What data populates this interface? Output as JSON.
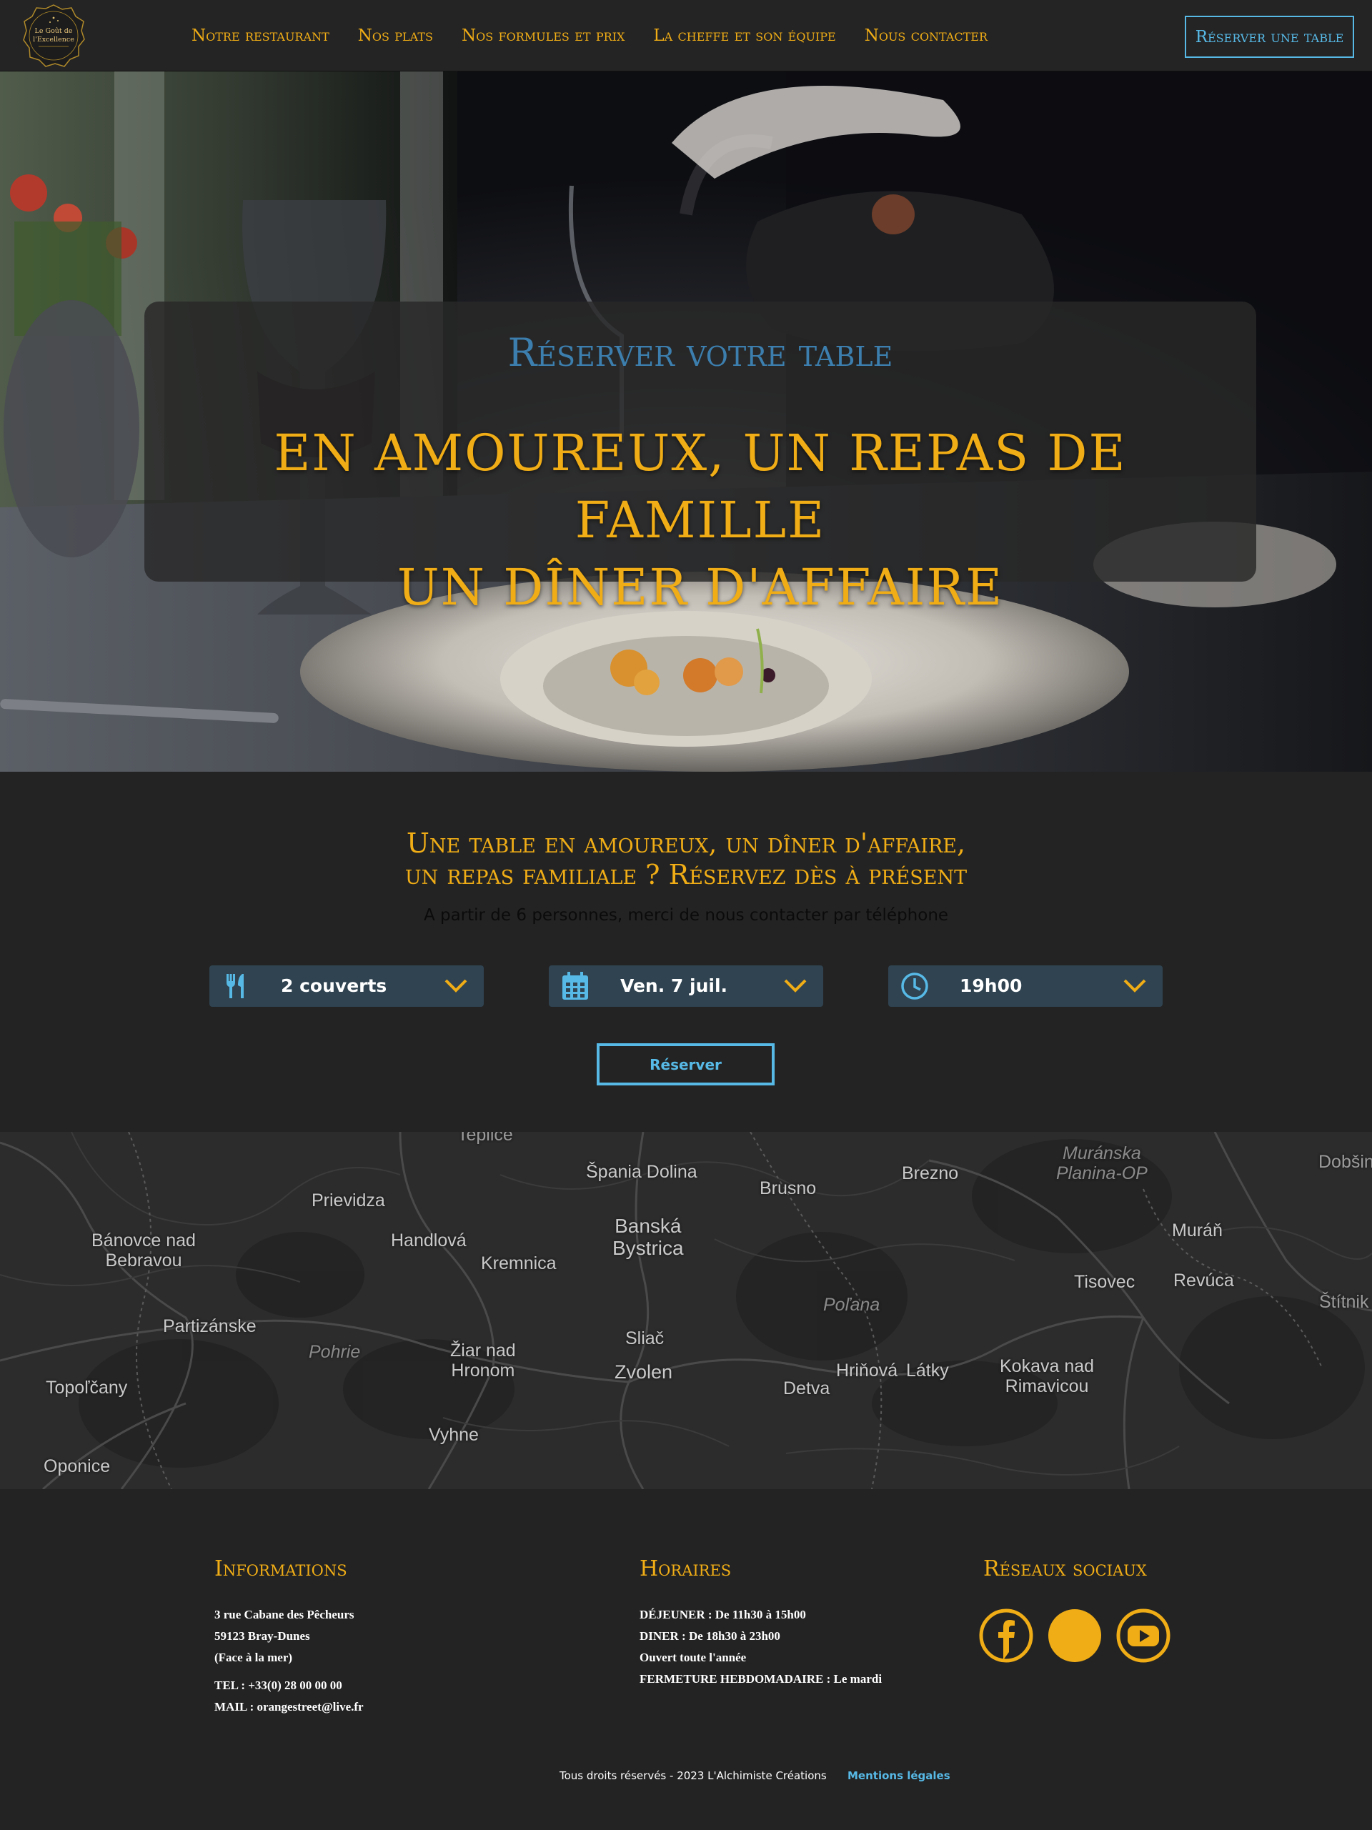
{
  "header": {
    "logo_text": [
      "Le Goût de",
      "l'Excellence"
    ],
    "nav": [
      "Notre restaurant",
      "Nos plats",
      "Nos formules et prix",
      "La cheffe et son équipe",
      "Nous contacter"
    ],
    "cta": "Réserver une table"
  },
  "hero": {
    "subtitle": "Réserver votre table",
    "title_line1": "en amoureux, un repas de famille",
    "title_line2": "un dîner d'affaire"
  },
  "reservation": {
    "title_line1": "Une table en amoureux, un dîner d'affaire,",
    "title_line2": "un repas familiale ? Réservez dès à présent",
    "note": "A partir de 6 personnes, merci de nous contacter par téléphone",
    "guests": {
      "icon": "cutlery-icon",
      "value": "2 couverts"
    },
    "date": {
      "icon": "calendar-icon",
      "value": "Ven. 7 juil."
    },
    "time": {
      "icon": "clock-icon",
      "value": "19h00"
    },
    "submit": "Réserver"
  },
  "map": {
    "labels": [
      {
        "text": "Teplice",
        "kind": "cut"
      },
      {
        "text": "Špania Dolina",
        "kind": "city"
      },
      {
        "text": "Brusno",
        "kind": "city"
      },
      {
        "text": "Brezno",
        "kind": "city"
      },
      {
        "text": "Muránska\nPlanina-OP",
        "kind": "region"
      },
      {
        "text": "Dobšin",
        "kind": "cut"
      },
      {
        "text": "Prievidza",
        "kind": "city"
      },
      {
        "text": "Bánovce nad\nBebravou",
        "kind": "city"
      },
      {
        "text": "Handlová",
        "kind": "city"
      },
      {
        "text": "Banská\nBystrica",
        "kind": "city"
      },
      {
        "text": "Kremnica",
        "kind": "city"
      },
      {
        "text": "Muráň",
        "kind": "city"
      },
      {
        "text": "Tisovec",
        "kind": "city"
      },
      {
        "text": "Revúca",
        "kind": "city"
      },
      {
        "text": "Štítnik",
        "kind": "cut"
      },
      {
        "text": "Poľana",
        "kind": "region"
      },
      {
        "text": "Partizánske",
        "kind": "city"
      },
      {
        "text": "Sliač",
        "kind": "city"
      },
      {
        "text": "Pohrie",
        "kind": "region"
      },
      {
        "text": "Žiar nad\nHronom",
        "kind": "city"
      },
      {
        "text": "Zvolen",
        "kind": "city"
      },
      {
        "text": "Hriňová",
        "kind": "city"
      },
      {
        "text": "Látky",
        "kind": "city"
      },
      {
        "text": "Kokava nad\nRimavicou",
        "kind": "city"
      },
      {
        "text": "Detva",
        "kind": "city"
      },
      {
        "text": "Topoľčany",
        "kind": "city"
      },
      {
        "text": "Vyhne",
        "kind": "city"
      },
      {
        "text": "Oponice",
        "kind": "city"
      }
    ]
  },
  "footer": {
    "info_title": "Informations",
    "address1": "3 rue Cabane des Pêcheurs",
    "address2": "59123 Bray-Dunes",
    "address3": "(Face à la mer)",
    "tel": "TEL : +33(0) 28 00 00 00",
    "mail": "MAIL : orangestreet@live.fr",
    "hours_title": "Horaires",
    "lunch": "DÉJEUNER : De 11h30 à 15h00",
    "dinner": "DINER : De 18h30 à 23h00",
    "open": "Ouvert toute l'année",
    "closing": "FERMETURE HEBDOMADAIRE : Le mardi",
    "social_title": "Réseaux sociaux",
    "copyright": "Tous droits réservés - 2023 L'Alchimiste Créations",
    "legal": "Mentions légales"
  },
  "colors": {
    "gold": "#f0ad16",
    "blue": "#57b9e6",
    "dark": "#232323",
    "select_bg": "#2f4350"
  }
}
